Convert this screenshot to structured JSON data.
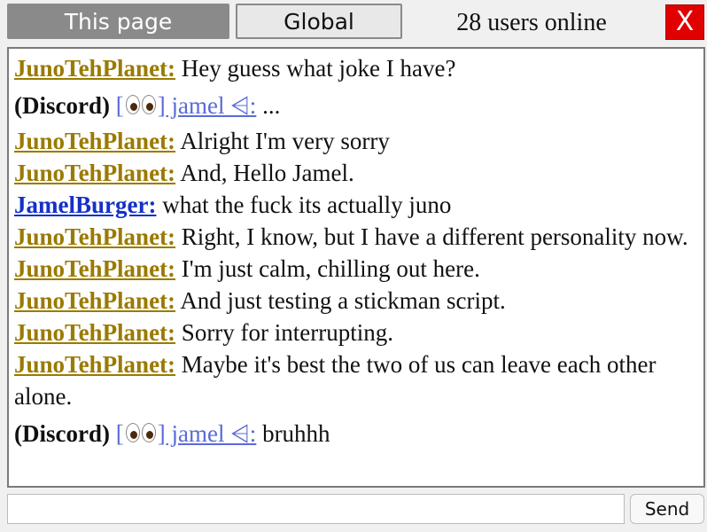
{
  "header": {
    "tab_this_page": "This page",
    "tab_global": "Global",
    "online_text": "28 users online",
    "close_label": "X"
  },
  "colors": {
    "user_gold": "#9a7a00",
    "user_blue": "#1530c8",
    "discord_link": "#5a6ad8",
    "close_red": "#e00000"
  },
  "messages": [
    {
      "user": "JunoTehPlanet:",
      "text": "Hey guess what joke I have?"
    },
    {
      "discord_tag": "(Discord)",
      "link_prefix": "[",
      "link_name": "] jamel ⩤:",
      "text": "..."
    },
    {
      "user": "JunoTehPlanet:",
      "text": "Alright I'm very sorry"
    },
    {
      "user": "JunoTehPlanet:",
      "text": "And, Hello Jamel."
    },
    {
      "user": "JamelBurger:",
      "text": "what the fuck its actually juno"
    },
    {
      "user": "JunoTehPlanet:",
      "text": "Right, I know, but I have a different personality now."
    },
    {
      "user": "JunoTehPlanet:",
      "text": "I'm just calm, chilling out here."
    },
    {
      "user": "JunoTehPlanet:",
      "text": "And just testing a stickman script."
    },
    {
      "user": "JunoTehPlanet:",
      "text": "Sorry for interrupting."
    },
    {
      "user": "JunoTehPlanet:",
      "text": "Maybe it's best the two of us can leave each other alone."
    },
    {
      "discord_tag": "(Discord)",
      "link_prefix": "[",
      "link_name": "] jamel ⩤:",
      "text": "bruhhh"
    }
  ],
  "input": {
    "value": "",
    "send_label": "Send"
  },
  "icons": {
    "discord_avatar": "eyes-emoji-icon"
  }
}
